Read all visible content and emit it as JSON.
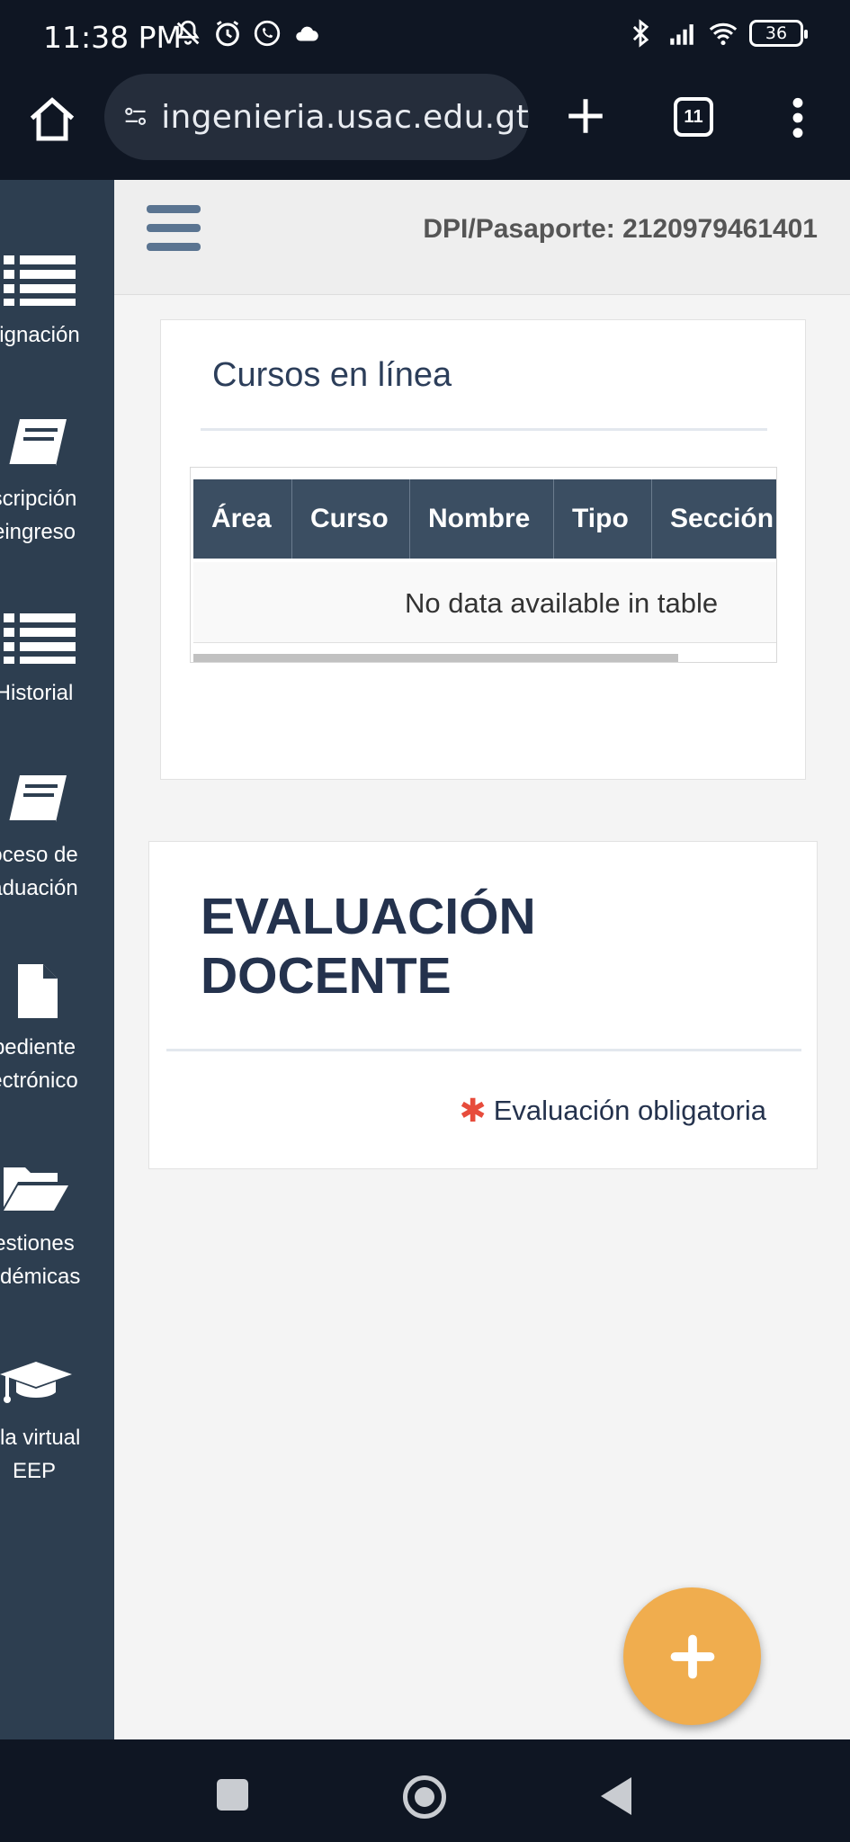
{
  "status_bar": {
    "time": "11:38 PM",
    "battery": "36",
    "icons_left": [
      "mute-bell-icon",
      "alarm-icon",
      "whatsapp-icon",
      "cloud-icon"
    ],
    "icons_right": [
      "bluetooth-icon",
      "signal-icon",
      "wifi-icon",
      "battery-icon"
    ]
  },
  "browser": {
    "url": "ingenieria.usac.edu.gt",
    "tab_count": "11"
  },
  "header": {
    "dpi_label": "DPI/Pasaporte: 2120979461401"
  },
  "sidebar": {
    "items": [
      {
        "label": "signación",
        "icon": "list-icon"
      },
      {
        "label": "scripción\neingreso",
        "icon": "book-icon"
      },
      {
        "label": "Historial",
        "icon": "list-icon"
      },
      {
        "label": "oceso de\naduación",
        "icon": "book-icon"
      },
      {
        "label": "pediente\nectrónico",
        "icon": "file-icon"
      },
      {
        "label": "estiones\nadémicas",
        "icon": "folder-open-icon"
      },
      {
        "label": "ula virtual\nEEP",
        "icon": "graduation-cap-icon"
      }
    ]
  },
  "cursos": {
    "title": "Cursos en línea",
    "columns": [
      "Área",
      "Curso",
      "Nombre",
      "Tipo",
      "Sección"
    ],
    "empty_message": "No data available in table"
  },
  "evaluacion": {
    "title": "EVALUACIÓN\nDOCENTE",
    "note": "Evaluación obligatoria"
  },
  "colors": {
    "sidebar": "#2d3e50",
    "table_header": "#3b4e62",
    "fab": "#f0ad4e",
    "asterisk": "#e74c3c",
    "heading": "#24324d"
  }
}
